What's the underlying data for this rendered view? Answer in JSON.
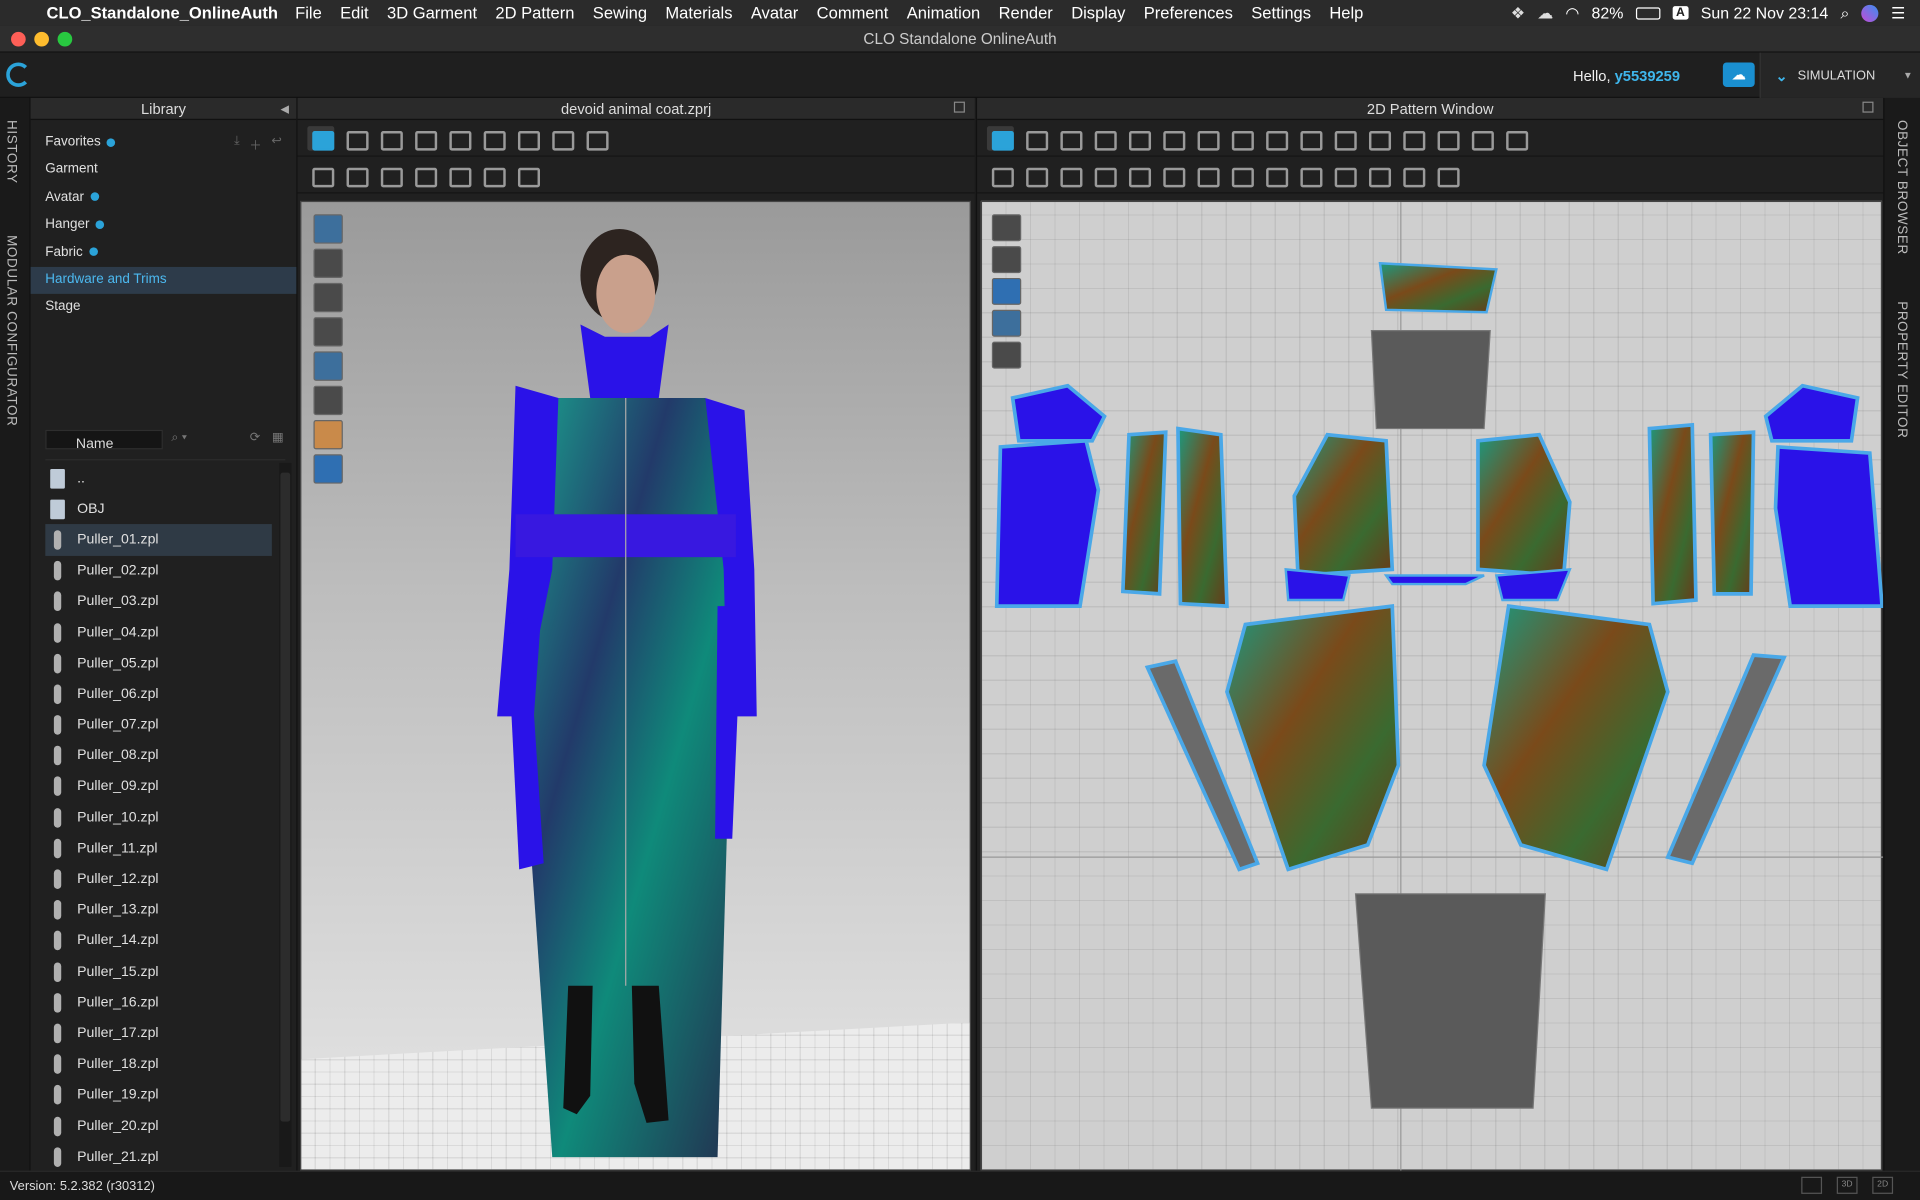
{
  "menubar": {
    "app_name": "CLO_Standalone_OnlineAuth",
    "items": [
      "File",
      "Edit",
      "3D Garment",
      "2D Pattern",
      "Sewing",
      "Materials",
      "Avatar",
      "Comment",
      "Animation",
      "Render",
      "Display",
      "Preferences",
      "Settings",
      "Help"
    ],
    "battery": "82%",
    "input_source": "A",
    "clock": "Sun 22 Nov  23:14"
  },
  "window": {
    "title": "CLO Standalone OnlineAuth"
  },
  "header": {
    "greeting": "Hello, ",
    "username": "y5539259",
    "mode_button": "SIMULATION"
  },
  "left_rail": {
    "tabs": [
      "HISTORY",
      "MODULAR CONFIGURATOR"
    ]
  },
  "right_rail": {
    "tabs": [
      "OBJECT BROWSER",
      "PROPERTY EDITOR"
    ]
  },
  "library": {
    "title": "Library",
    "categories": [
      {
        "label": "Favorites",
        "badge": true
      },
      {
        "label": "Garment",
        "badge": false
      },
      {
        "label": "Avatar",
        "badge": true
      },
      {
        "label": "Hanger",
        "badge": true
      },
      {
        "label": "Fabric",
        "badge": true
      },
      {
        "label": "Hardware and Trims",
        "badge": false,
        "selected": true
      },
      {
        "label": "Stage",
        "badge": false
      }
    ],
    "column_name": "Name",
    "files": [
      "..",
      "OBJ",
      "Puller_01.zpl",
      "Puller_02.zpl",
      "Puller_03.zpl",
      "Puller_04.zpl",
      "Puller_05.zpl",
      "Puller_06.zpl",
      "Puller_07.zpl",
      "Puller_08.zpl",
      "Puller_09.zpl",
      "Puller_10.zpl",
      "Puller_11.zpl",
      "Puller_12.zpl",
      "Puller_13.zpl",
      "Puller_14.zpl",
      "Puller_15.zpl",
      "Puller_16.zpl",
      "Puller_17.zpl",
      "Puller_18.zpl",
      "Puller_19.zpl",
      "Puller_20.zpl",
      "Puller_21.zpl"
    ],
    "selected_file": "Puller_01.zpl"
  },
  "panel3d": {
    "title": "devoid animal coat.zprj"
  },
  "panel2d": {
    "title": "2D Pattern Window"
  },
  "status": {
    "version": "Version: 5.2.382 (r30312)",
    "view_buttons": [
      "3D",
      "2D"
    ]
  },
  "colors": {
    "accent": "#2ba3d9",
    "garment_blue": "#2a12e8",
    "pattern_outline": "#4aa8e8"
  }
}
